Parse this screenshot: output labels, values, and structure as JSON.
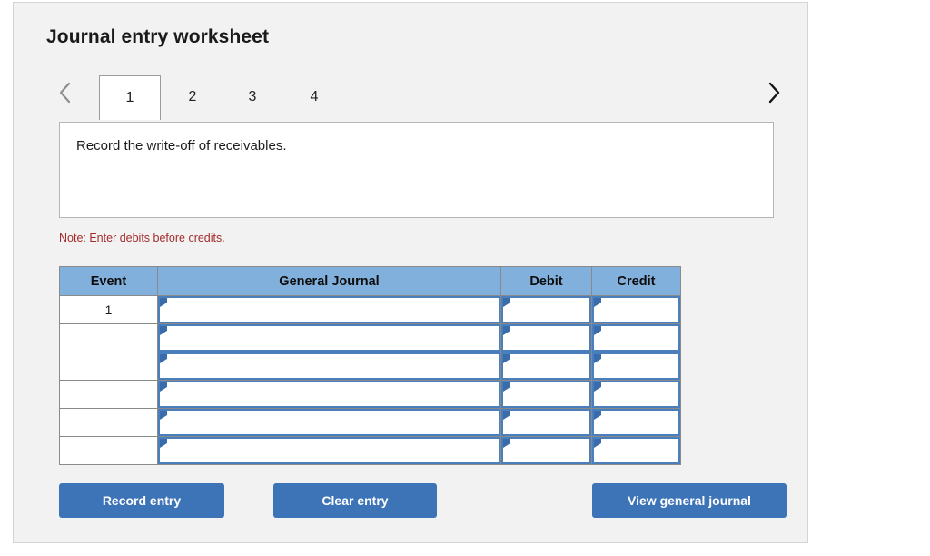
{
  "card": {
    "title": "Journal entry worksheet"
  },
  "nav": {
    "prev_icon": "chevron-left-icon",
    "next_icon": "chevron-right-icon",
    "prev_enabled": false,
    "next_enabled": true,
    "prev_color": "#8e8e8e",
    "next_color": "#151515"
  },
  "tabs": {
    "active_index": 0,
    "items": [
      {
        "label": "1"
      },
      {
        "label": "2"
      },
      {
        "label": "3"
      },
      {
        "label": "4"
      }
    ]
  },
  "panel": {
    "text": "Record the write-off of receivables."
  },
  "note": {
    "text": "Note: Enter debits before credits.",
    "color": "#a52b2b"
  },
  "table": {
    "headers": {
      "event": "Event",
      "general_journal": "General Journal",
      "debit": "Debit",
      "credit": "Credit"
    },
    "header_bg": "#82b0dd",
    "rows": [
      {
        "event": "1",
        "general_journal": "",
        "debit": "",
        "credit": ""
      },
      {
        "event": "",
        "general_journal": "",
        "debit": "",
        "credit": ""
      },
      {
        "event": "",
        "general_journal": "",
        "debit": "",
        "credit": ""
      },
      {
        "event": "",
        "general_journal": "",
        "debit": "",
        "credit": ""
      },
      {
        "event": "",
        "general_journal": "",
        "debit": "",
        "credit": ""
      },
      {
        "event": "",
        "general_journal": "",
        "debit": "",
        "credit": ""
      }
    ]
  },
  "buttons": {
    "record": "Record entry",
    "clear": "Clear entry",
    "view": "View general journal",
    "color": "#3d74b8"
  }
}
